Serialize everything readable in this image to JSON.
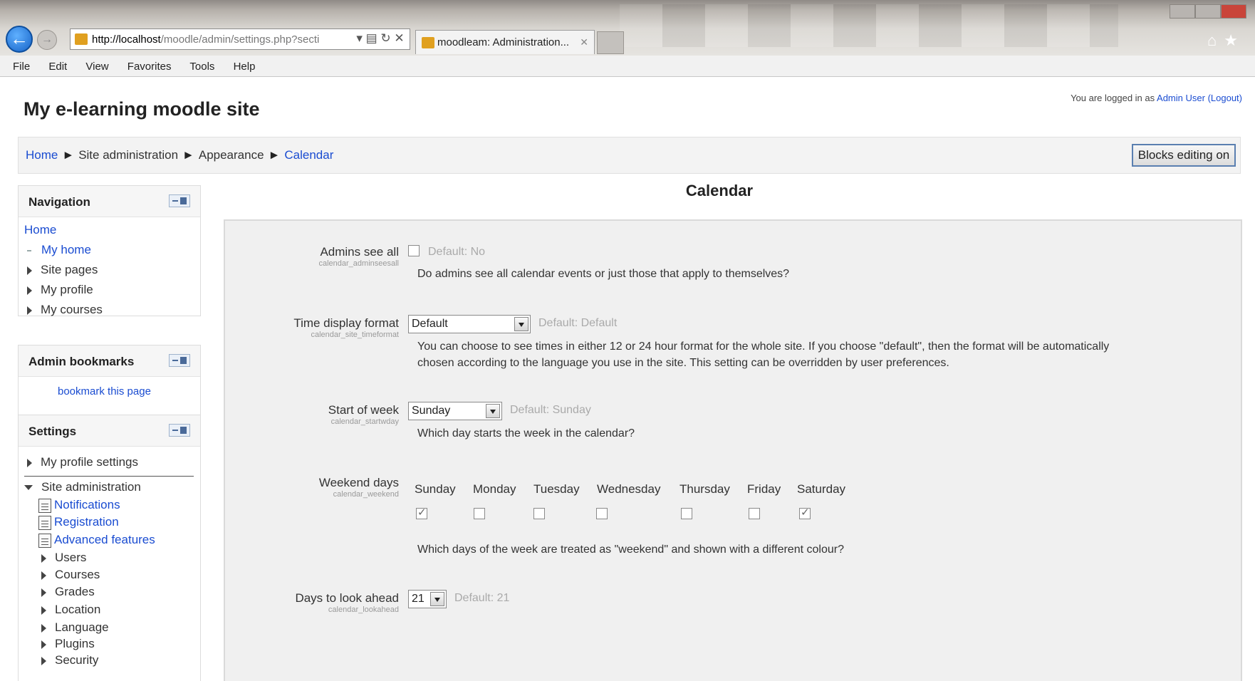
{
  "browser": {
    "url_host": "http://localhost",
    "url_rest": "/moodle/admin/settings.php?secti",
    "tab_title": "moodleam: Administration...",
    "menu": [
      "File",
      "Edit",
      "View",
      "Favorites",
      "Tools",
      "Help"
    ]
  },
  "site": {
    "title": "My e-learning moodle site",
    "login_prefix": "You are logged in as",
    "login_user": "Admin User",
    "logout": "(Logout)"
  },
  "breadcrumb": {
    "home": "Home",
    "site_admin": "Site administration",
    "appearance": "Appearance",
    "calendar": "Calendar",
    "separator": "►"
  },
  "blocks_editing_button": "Blocks editing on",
  "navigation": {
    "title": "Navigation",
    "home": "Home",
    "my_home": "My home",
    "site_pages": "Site pages",
    "my_profile": "My profile",
    "my_courses": "My courses"
  },
  "admin_bookmarks": {
    "title": "Admin bookmarks",
    "bookmark_link": "bookmark this page"
  },
  "settings_block": {
    "title": "Settings",
    "my_profile_settings": "My profile settings",
    "site_administration": "Site administration",
    "notifications": "Notifications",
    "registration": "Registration",
    "advanced_features": "Advanced features",
    "users": "Users",
    "courses": "Courses",
    "grades": "Grades",
    "location": "Location",
    "language": "Language",
    "plugins": "Plugins",
    "security": "Security"
  },
  "main": {
    "title": "Calendar",
    "admins_see_all": {
      "label": "Admins see all",
      "sublabel": "calendar_adminseesall",
      "checked": false,
      "default": "Default: No",
      "description": "Do admins see all calendar events or just those that apply to themselves?"
    },
    "time_display_format": {
      "label": "Time display format",
      "sublabel": "calendar_site_timeformat",
      "value": "Default",
      "default": "Default: Default",
      "description_1": "You can choose to see times in either 12 or 24 hour format for the whole site. If you choose \"default\", then the format will be automatically",
      "description_2": "chosen according to the language you use in the site. This setting can be overridden by user preferences."
    },
    "start_of_week": {
      "label": "Start of week",
      "sublabel": "calendar_startwday",
      "value": "Sunday",
      "default": "Default: Sunday",
      "description": "Which day starts the week in the calendar?"
    },
    "weekend_days": {
      "label": "Weekend days",
      "sublabel": "calendar_weekend",
      "days": [
        "Sunday",
        "Monday",
        "Tuesday",
        "Wednesday",
        "Thursday",
        "Friday",
        "Saturday"
      ],
      "checked": [
        true,
        false,
        false,
        false,
        false,
        false,
        true
      ],
      "description": "Which days of the week are treated as \"weekend\" and shown with a different colour?"
    },
    "days_to_look_ahead": {
      "label": "Days to look ahead",
      "sublabel": "calendar_lookahead",
      "value": "21",
      "default": "Default: 21"
    }
  }
}
